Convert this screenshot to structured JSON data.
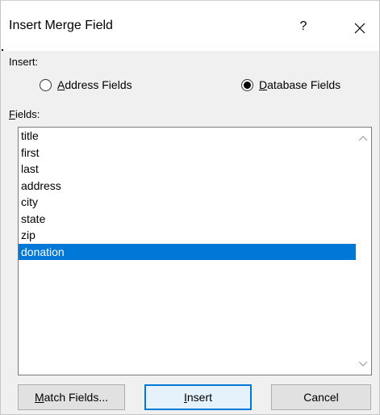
{
  "dialog": {
    "title": "Insert Merge Field",
    "help_label": "?",
    "close_icon": "close-icon"
  },
  "insert_section": {
    "label": "Insert:",
    "options": [
      {
        "accel": "A",
        "rest": "ddress Fields",
        "selected": false
      },
      {
        "accel": "D",
        "rest": "atabase Fields",
        "selected": true
      }
    ]
  },
  "fields_section": {
    "label_accel": "F",
    "label_rest": "ields:",
    "items": [
      "title",
      "first",
      "last",
      "address",
      "city",
      "state",
      "zip",
      "donation"
    ],
    "selected_index": 7
  },
  "buttons": {
    "match_accel": "M",
    "match_rest": "atch Fields...",
    "insert_accel": "I",
    "insert_rest": "nsert",
    "cancel": "Cancel"
  },
  "colors": {
    "selection": "#0078d7",
    "dialog_bg": "#f0f0f0"
  }
}
